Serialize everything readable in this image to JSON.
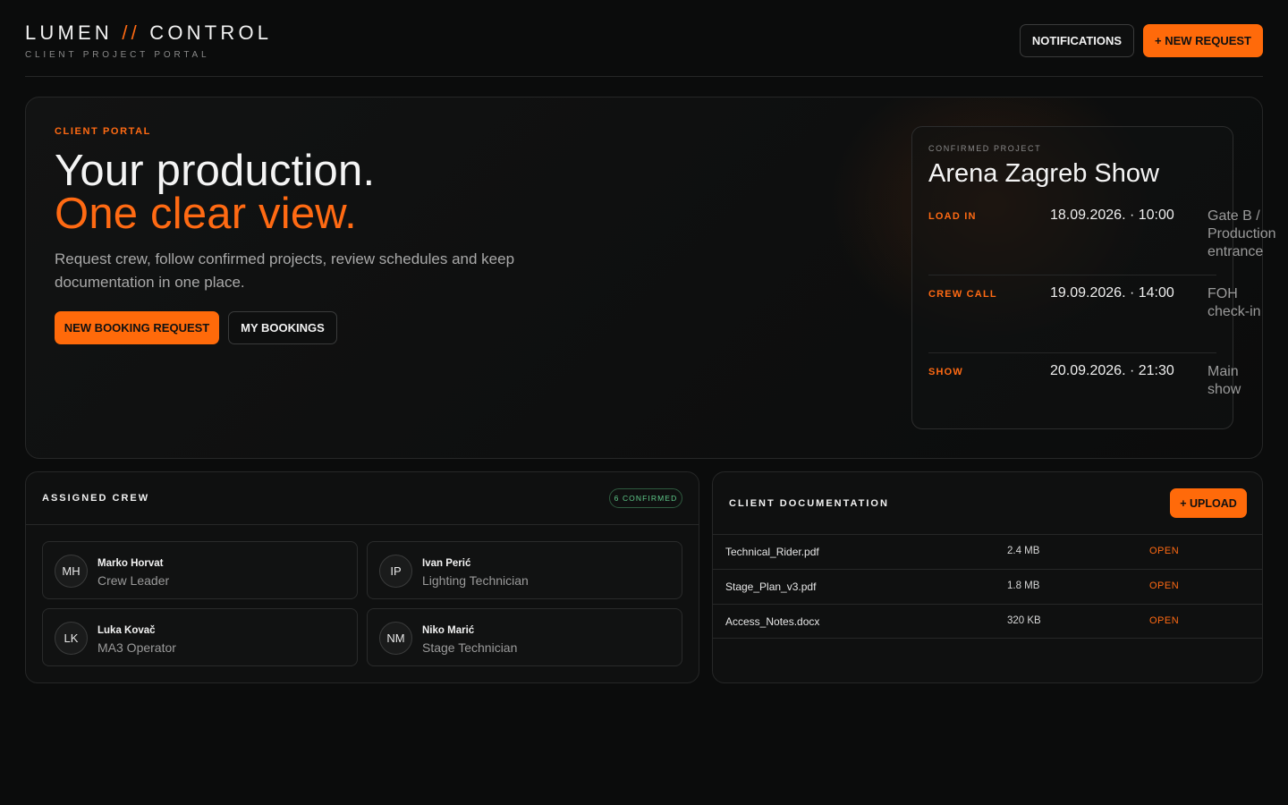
{
  "brand": {
    "left": "LUMEN",
    "sep": "//",
    "right": "CONTROL",
    "tagline": "CLIENT PROJECT PORTAL"
  },
  "header": {
    "notifications_label": "NOTIFICATIONS",
    "new_request_label": "+ NEW REQUEST"
  },
  "hero": {
    "eyebrow": "CLIENT PORTAL",
    "headline_1": "Your production.",
    "headline_2": "One clear view.",
    "lead": "Request crew, follow confirmed projects, review schedules and keep documentation in one place.",
    "primary_label": "NEW BOOKING REQUEST",
    "secondary_label": "MY BOOKINGS"
  },
  "project": {
    "eyebrow": "CONFIRMED PROJECT",
    "title": "Arena Zagreb Show",
    "schedule": [
      {
        "label": "LOAD IN",
        "time": "18.09.2026. · 10:00",
        "place": "Gate B / Production entrance"
      },
      {
        "label": "CREW CALL",
        "time": "19.09.2026. · 14:00",
        "place": "FOH check-in"
      },
      {
        "label": "SHOW",
        "time": "20.09.2026. · 21:30",
        "place": "Main show"
      }
    ]
  },
  "crew": {
    "title": "ASSIGNED CREW",
    "badge": "6 CONFIRMED",
    "members": [
      {
        "initials": "MH",
        "name": "Marko Horvat",
        "role": "Crew Leader"
      },
      {
        "initials": "IP",
        "name": "Ivan Perić",
        "role": "Lighting Technician"
      },
      {
        "initials": "LK",
        "name": "Luka Kovač",
        "role": "MA3 Operator"
      },
      {
        "initials": "NM",
        "name": "Niko Marić",
        "role": "Stage Technician"
      }
    ]
  },
  "docs": {
    "title": "CLIENT DOCUMENTATION",
    "upload_label": "+ UPLOAD",
    "files": [
      {
        "name": "Technical_Rider.pdf",
        "size": "2.4 MB",
        "action": "OPEN"
      },
      {
        "name": "Stage_Plan_v3.pdf",
        "size": "1.8 MB",
        "action": "OPEN"
      },
      {
        "name": "Access_Notes.docx",
        "size": "320 KB",
        "action": "OPEN"
      }
    ]
  },
  "colors": {
    "accent": "#ff6a13",
    "background": "#0b0c0c",
    "confirmed": "#5fc98a"
  }
}
